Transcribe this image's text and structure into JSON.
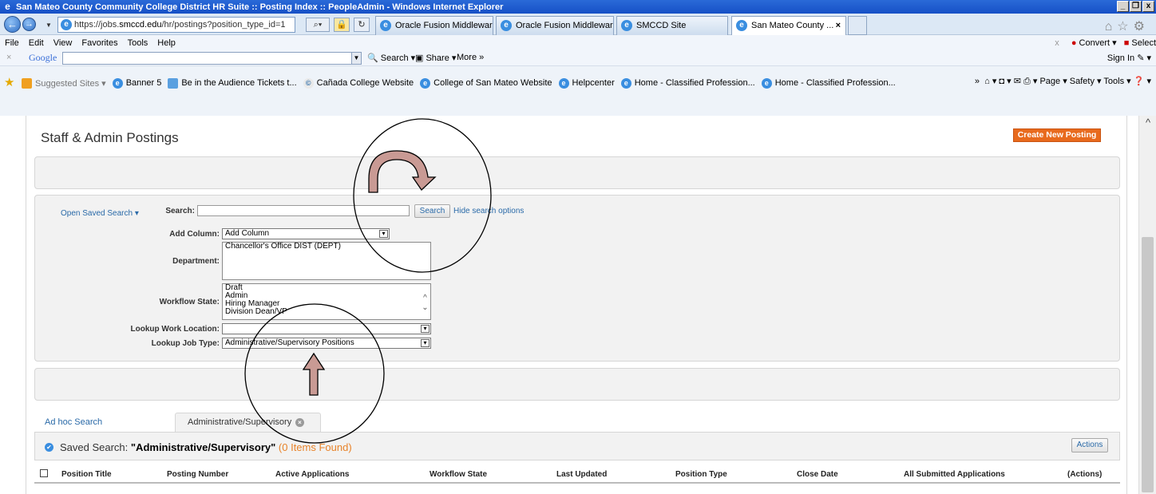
{
  "browser": {
    "title": "San Mateo County Community College District HR Suite :: Posting Index :: PeopleAdmin - Windows Internet Explorer",
    "url_prefix": "https://jobs.",
    "url_domain": "smccd.edu",
    "url_path": "/hr/postings?position_type_id=1",
    "tabs": [
      {
        "label": "Oracle Fusion Middlewar..."
      },
      {
        "label": "Oracle Fusion Middlewar..."
      },
      {
        "label": "SMCCD Site"
      },
      {
        "label": "San Mateo County ..."
      }
    ],
    "menu": [
      "File",
      "Edit",
      "View",
      "Favorites",
      "Tools",
      "Help"
    ],
    "menu_right": {
      "convert": "Convert",
      "select": "Select"
    },
    "google": {
      "logo": "Google",
      "search": "Search",
      "share": "Share",
      "more": "More »",
      "signin": "Sign In"
    },
    "favorites": [
      {
        "label": "Suggested Sites ▾"
      },
      {
        "label": "Banner 5"
      },
      {
        "label": "Be in the Audience Tickets t..."
      },
      {
        "label": "Cañada College Website"
      },
      {
        "label": "College of San Mateo Website"
      },
      {
        "label": "Helpcenter"
      },
      {
        "label": "Home - Classified Profession..."
      },
      {
        "label": "Home - Classified Profession..."
      }
    ],
    "command_bar": "Page ▾   Safety ▾   Tools ▾"
  },
  "page": {
    "title": "Staff & Admin Postings",
    "create_button": "Create New Posting",
    "search": {
      "open_saved": "Open Saved Search ▾",
      "search_label": "Search:",
      "search_value": "",
      "search_button": "Search",
      "hide_options": "Hide search options",
      "add_column_label": "Add Column:",
      "add_column_value": "Add Column",
      "department_label": "Department:",
      "department_value": "Chancellor's Office DIST (DEPT)",
      "workflow_label": "Workflow State:",
      "workflow_options": [
        "Draft",
        "Admin",
        "Hiring Manager",
        "Division Dean/VP"
      ],
      "location_label": "Lookup Work Location:",
      "location_value": "",
      "jobtype_label": "Lookup Job Type:",
      "jobtype_value": "Administrative/Supervisory Positions"
    },
    "tabs": {
      "adhoc": "Ad hoc Search",
      "saved": "Administrative/Supervisory"
    },
    "saved_search": {
      "prefix": "Saved Search: ",
      "name": "\"Administrative/Supervisory\"",
      "count": "(0 Items Found)",
      "actions": "Actions"
    },
    "columns": [
      "Position Title",
      "Posting Number",
      "Active Applications",
      "Workflow State",
      "Last Updated",
      "Position Type",
      "Close Date",
      "All Submitted Applications",
      "(Actions)"
    ]
  },
  "colors": {
    "accent": "#e86a1d",
    "link": "#2a6aa8",
    "annotation_arrow": "#c99a94"
  }
}
